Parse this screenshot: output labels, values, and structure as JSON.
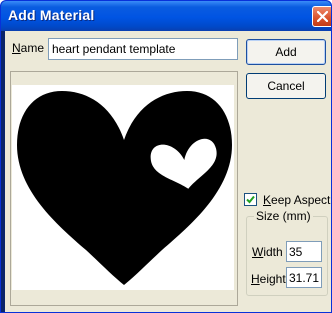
{
  "window": {
    "title": "Add Material"
  },
  "name_field": {
    "label_underlined": "N",
    "label_rest": "ame",
    "value": "heart pendant template"
  },
  "buttons": {
    "add": "Add",
    "cancel": "Cancel"
  },
  "preview": {
    "image_icon": "heart-shape-icon"
  },
  "keep_aspect": {
    "label_underlined": "K",
    "label_rest": "eep Aspect",
    "checked": true
  },
  "size_group": {
    "title": "Size (mm)",
    "width_label_underlined": "W",
    "width_label_rest": "idth",
    "width_value": "35",
    "height_label_underlined": "H",
    "height_label_rest": "eight",
    "height_value": "31.71"
  },
  "colors": {
    "titlebar": "#0054e3",
    "client": "#ece9d8",
    "close": "#d9522c"
  }
}
